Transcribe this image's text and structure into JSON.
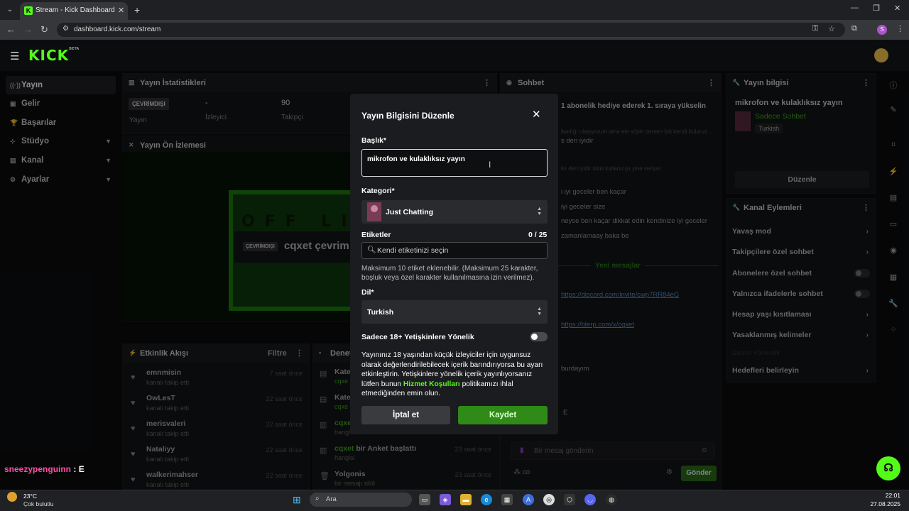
{
  "browser": {
    "tab_title": "Stream - Kick Dashboard",
    "url": "dashboard.kick.com/stream",
    "profile_initial": "S"
  },
  "header": {
    "logo": "KICK",
    "beta": "BETA"
  },
  "sidebar": {
    "items": [
      {
        "label": "Yayın"
      },
      {
        "label": "Gelir"
      },
      {
        "label": "Başarılar"
      },
      {
        "label": "Stüdyo"
      },
      {
        "label": "Kanal"
      },
      {
        "label": "Ayarlar"
      }
    ]
  },
  "stats": {
    "title": "Yayın İstatistikleri",
    "status_badge": "ÇEVRİMDIŞI",
    "status_label": "Yayın",
    "viewers_value": "-",
    "viewers_label": "İzleyici",
    "followers_value": "90",
    "followers_label": "Takipçi"
  },
  "preview": {
    "title": "Yayın Ön İzlemesi",
    "offline_text": "OFF LINE",
    "badge": "ÇEVRİMDIŞI",
    "channel_text": "cqxet çevrim"
  },
  "activity": {
    "title": "Etkinlik Akışı",
    "filter": "Filtre",
    "items": [
      {
        "name": "emnmisin",
        "sub": "kanalı takip etti",
        "time": "7 saat önce"
      },
      {
        "name": "OwLesT",
        "sub": "kanalı takip etti",
        "time": "22 saat önce"
      },
      {
        "name": "merisvaleri",
        "sub": "kanalı takip etti",
        "time": "22 saat önce"
      },
      {
        "name": "Nataliyy",
        "sub": "kanalı takip etti",
        "time": "22 saat önce"
      },
      {
        "name": "walkerimahser",
        "sub": "kanalı takip etti",
        "time": "22 saat önce"
      }
    ]
  },
  "moderation": {
    "title": "Denetim",
    "items": [
      {
        "name": "Kate",
        "green": "",
        "sub": "cqxe",
        "time": ""
      },
      {
        "name": "Kate",
        "green": "",
        "sub": "cqxe",
        "time": ""
      },
      {
        "name": "",
        "green": "cqxe",
        "sub": "hangis",
        "time": ""
      },
      {
        "name": " bir Anket başlattı",
        "green": "cqxet",
        "sub": "hangisi",
        "time": "23 saat önce"
      },
      {
        "name": "Yolgonis",
        "green": "",
        "sub": "bir mesajı sildi",
        "time": "23 saat önce"
      }
    ]
  },
  "chat": {
    "title": "Sohbet",
    "pinned": "1 abonelik hediye ederek 1. sıraya yükselin",
    "lines": [
      "ikarlığı ulaşıyorum ama ele söyle dersen bık kendi buluruz...",
      "s den iyidir",
      "ks den iyidir izinli kullanıcıyı yine veriyor",
      "i iyi geceler ben kaçar",
      "iyi geceler size",
      "neyse ben kaçar dikkat edin kendinize iyi geceler",
      "zamanlamaay baka be"
    ],
    "new_messages": "Yeni mesajlar",
    "link1": "https://discord.com/invite/cwp7RR84eG",
    "link2": "https://blerp.com/x/cqxet",
    "line_a": "burdayım",
    "line_b": "E",
    "input_placeholder": "Bir mesaj gönderin",
    "send": "Gönder",
    "user_line_name": "sneezypenguinn",
    "user_line_msg": ": E"
  },
  "stream_info": {
    "title": "Yayın bilgisi",
    "stream_title": "mikrofon ve kulaklıksız yayın",
    "category": "Sadece Sohbet",
    "language": "Turkish",
    "edit": "Düzenle"
  },
  "channel_actions": {
    "title": "Kanal Eylemleri",
    "items": [
      {
        "label": "Yavaş mod",
        "kind": "chev"
      },
      {
        "label": "Takipçilere özel sohbet",
        "kind": "chev"
      },
      {
        "label": "Abonelere özel sohbet",
        "kind": "toggle"
      },
      {
        "label": "Yalnızca ifadelerle sohbet",
        "kind": "toggle"
      },
      {
        "label": "Hesap yaşı kısıtlaması",
        "kind": "chev"
      },
      {
        "label": "Yasaklanmış kelimeler",
        "kind": "chev"
      },
      {
        "label": "İzleyici Yönlendir",
        "kind": "none"
      },
      {
        "label": "Hedefleri belirleyin",
        "kind": "chev"
      }
    ]
  },
  "modal": {
    "title": "Yayın Bilgisini Düzenle",
    "title_label": "Başlık*",
    "title_value": "mikrofon ve kulaklıksız yayın",
    "category_label": "Kategori*",
    "category_value": "Just Chatting",
    "tags_label": "Etiketler",
    "tags_count": "0 / 25",
    "tags_placeholder": "Kendi etiketinizi seçin",
    "tags_help": "Maksimum 10 etiket eklenebilir. (Maksimum 25 karakter, boşluk veya özel karakter kullanılmasına izin verilmez).",
    "language_label": "Dil*",
    "language_value": "Turkish",
    "adult_label": "Sadece 18+ Yetişkinlere Yönelik",
    "adult_help_1": "Yayınınız 18 yaşından küçük izleyiciler için uygunsuz olarak değerlendirilebilecek içerik barındırıyorsa bu ayarı etkinleştirin. Yetişkinlere yönelik içerik yayınlıyorsanız lütfen bunun ",
    "adult_help_link": "Hizmet Koşulları",
    "adult_help_2": " politikamızı ihlal etmediğinden emin olun.",
    "cancel": "İptal et",
    "save": "Kaydet"
  },
  "taskbar": {
    "temp": "23°C",
    "weather": "Çok bulutlu",
    "search": "Ara",
    "time": "22:01",
    "date": "27.08.2025"
  },
  "colors": {
    "accent": "#53fc18",
    "save_button": "#2f8a17",
    "background": "#0b0c0e"
  }
}
